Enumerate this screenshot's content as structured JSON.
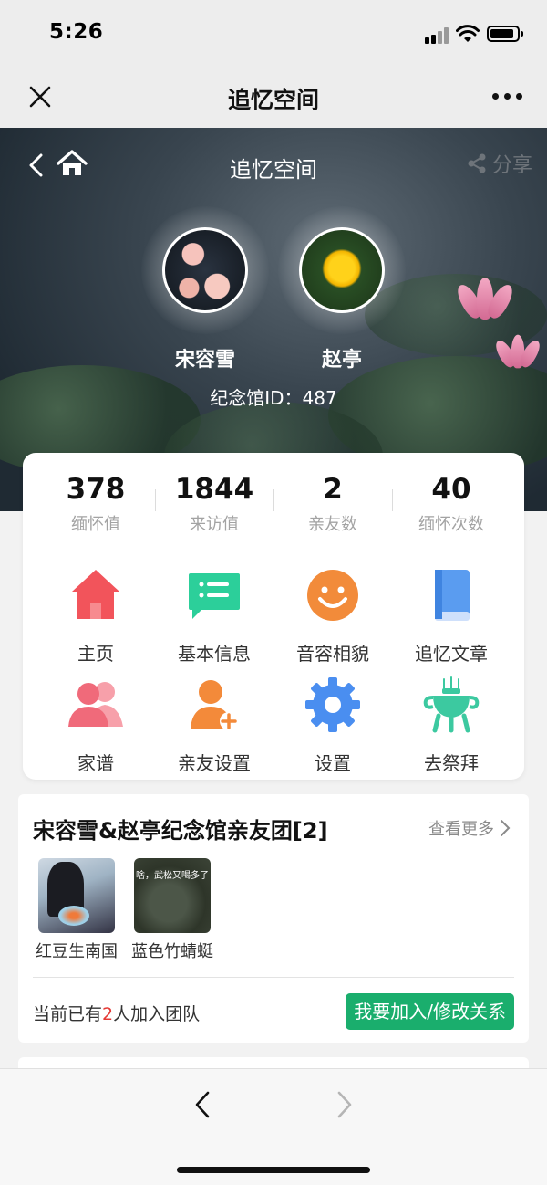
{
  "status": {
    "time": "5:26"
  },
  "nav": {
    "title": "追忆空间"
  },
  "hero": {
    "title": "追忆空间",
    "share_label": "分享",
    "person1": "宋容雪",
    "person2": "赵亭",
    "hall_id": "纪念馆ID：487"
  },
  "stats": [
    {
      "value": "378",
      "label": "缅怀值"
    },
    {
      "value": "1844",
      "label": "来访值"
    },
    {
      "value": "2",
      "label": "亲友数"
    },
    {
      "value": "40",
      "label": "缅怀次数"
    }
  ],
  "menu": [
    {
      "label": "主页",
      "icon": "home-icon"
    },
    {
      "label": "基本信息",
      "icon": "info-list-icon"
    },
    {
      "label": "音容相貌",
      "icon": "smile-face-icon"
    },
    {
      "label": "追忆文章",
      "icon": "book-icon"
    },
    {
      "label": "家谱",
      "icon": "family-icon"
    },
    {
      "label": "亲友设置",
      "icon": "add-friend-icon"
    },
    {
      "label": "设置",
      "icon": "gear-icon"
    },
    {
      "label": "去祭拜",
      "icon": "incense-burner-icon"
    }
  ],
  "friends": {
    "title": "宋容雪&赵亭纪念馆亲友团[2]",
    "more_label": "查看更多",
    "members": [
      {
        "name": "红豆生南国"
      },
      {
        "name": "蓝色竹蜻蜓",
        "caption": "啥，武松又喝多了"
      }
    ],
    "count_prefix": "当前已有",
    "count": "2",
    "count_suffix": "人加入团队",
    "join_label": "我要加入/修改关系"
  },
  "colors": {
    "accent_green": "#1aae6d",
    "count_red": "#e53935",
    "home_red": "#f2545b",
    "info_green": "#2ccf9a",
    "smile_orange": "#f28b3a",
    "book_blue": "#5a9cf0",
    "family_pink": "#f06a7a",
    "friend_orange": "#f38a3a",
    "gear_blue": "#4a8ef0",
    "burner_green": "#3cc9a0"
  }
}
